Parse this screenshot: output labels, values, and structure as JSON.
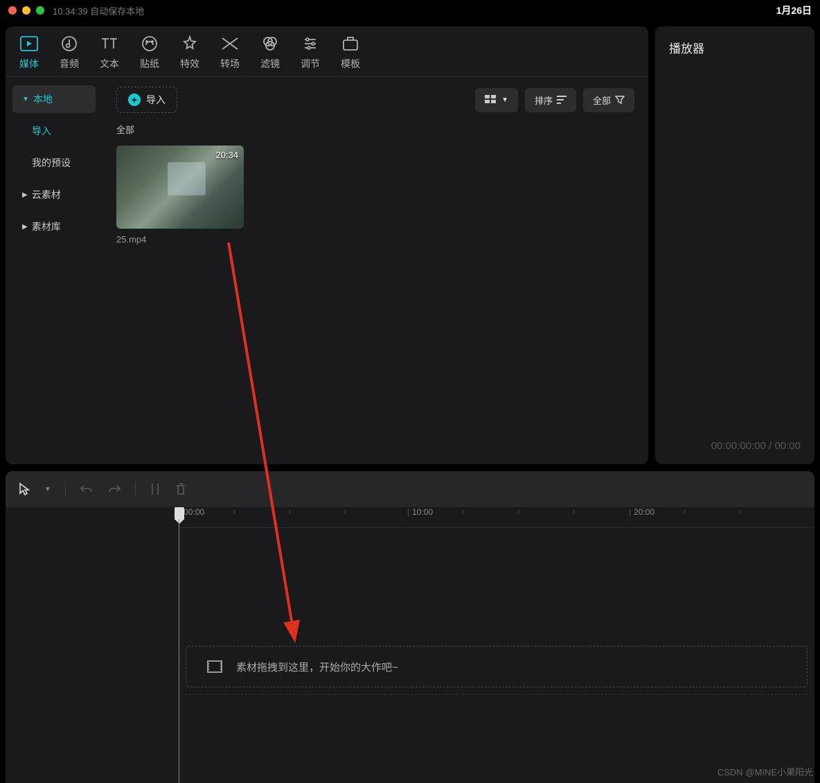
{
  "titlebar": {
    "time": "10:34:39",
    "autosave": "自动保存本地",
    "date": "1月26日"
  },
  "top_tabs": [
    {
      "label": "媒体",
      "icon": "media"
    },
    {
      "label": "音频",
      "icon": "audio"
    },
    {
      "label": "文本",
      "icon": "text"
    },
    {
      "label": "贴纸",
      "icon": "sticker"
    },
    {
      "label": "特效",
      "icon": "effect"
    },
    {
      "label": "转场",
      "icon": "transition"
    },
    {
      "label": "滤镜",
      "icon": "filter"
    },
    {
      "label": "调节",
      "icon": "adjust"
    },
    {
      "label": "模板",
      "icon": "template"
    }
  ],
  "sidebar": {
    "local": "本地",
    "import": "导入",
    "preset": "我的预设",
    "cloud": "云素材",
    "library": "素材库"
  },
  "toolbar": {
    "import_label": "导入",
    "sort_label": "排序",
    "all_label": "全部"
  },
  "section_all": "全部",
  "media": {
    "duration": "20:34",
    "filename": "25.mp4"
  },
  "player": {
    "title": "播放器",
    "time_current": "00:00:00:00",
    "time_sep": " / ",
    "time_total": "00:00"
  },
  "ruler": {
    "t0": "00:00",
    "t1": "10:00",
    "t2": "20:00"
  },
  "timeline": {
    "drop_hint": "素材拖拽到这里，开始你的大作吧~"
  },
  "watermark": "CSDN @MINE小果阳光"
}
